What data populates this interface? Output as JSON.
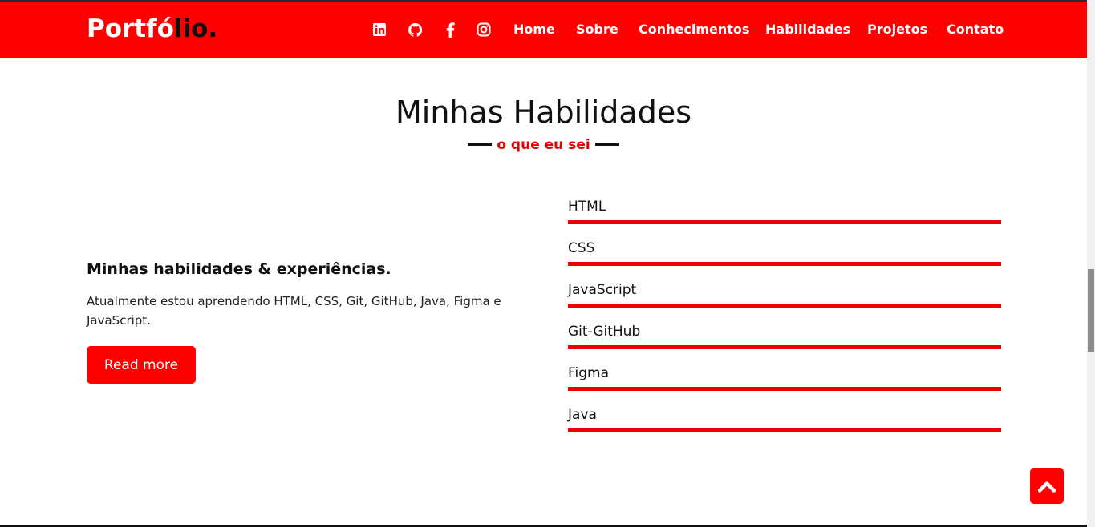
{
  "brand": {
    "logo_part1": "Portfó",
    "logo_part2": "lio."
  },
  "nav": {
    "icons": [
      "linkedin-icon",
      "github-icon",
      "facebook-icon",
      "instagram-icon"
    ],
    "links": [
      "Home",
      "Sobre",
      "Conhecimentos",
      "Habilidades",
      "Projetos",
      "Contato"
    ]
  },
  "section": {
    "title": "Minhas Habilidades",
    "subtitle": "o que eu sei"
  },
  "about": {
    "heading": "Minhas habilidades & experiências.",
    "text": "Atualmente estou aprendendo HTML, CSS, Git, GitHub, Java, Figma e JavaScript.",
    "button": "Read more"
  },
  "skills": [
    {
      "name": "HTML",
      "level": 1.0
    },
    {
      "name": "CSS",
      "level": 1.0
    },
    {
      "name": "JavaScript",
      "level": 1.0
    },
    {
      "name": "Git-GitHub",
      "level": 1.0
    },
    {
      "name": "Figma",
      "level": 1.0
    },
    {
      "name": "Java",
      "level": 1.0
    }
  ],
  "colors": {
    "accent": "#ff0000",
    "text": "#111111"
  },
  "scroll_top_icon": "chevron-up-icon"
}
